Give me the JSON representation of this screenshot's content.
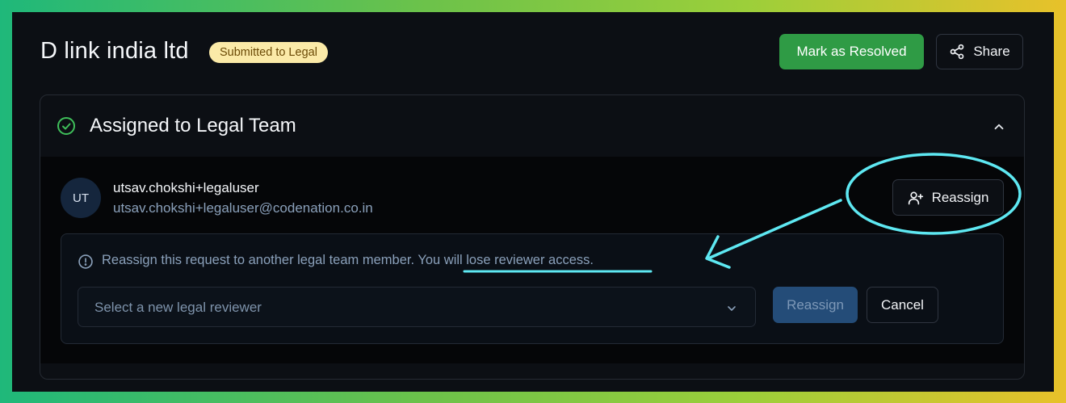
{
  "header": {
    "title": "D link india ltd",
    "status_badge": "Submitted to Legal",
    "resolve_label": "Mark as Resolved",
    "share_label": "Share",
    "share_icon": "share-icon"
  },
  "section": {
    "title": "Assigned to Legal Team",
    "status_icon": "check-circle-icon",
    "collapse_icon": "chevron-up-icon",
    "assignee": {
      "initials": "UT",
      "name": "utsav.chokshi+legaluser",
      "email": "utsav.chokshi+legaluser@codenation.co.in"
    },
    "reassign_label": "Reassign",
    "reassign_icon": "user-plus-icon"
  },
  "reassign_panel": {
    "notice": "Reassign this request to another legal team member.",
    "warning": "You will lose reviewer access.",
    "info_icon": "info-circle-icon",
    "select_placeholder": "Select a new legal reviewer",
    "confirm_label": "Reassign",
    "cancel_label": "Cancel"
  },
  "colors": {
    "background": "#0c0f14",
    "primary_green": "#2f9b45",
    "badge_bg": "#fbeaa8",
    "annotation": "#5ee8f2"
  }
}
